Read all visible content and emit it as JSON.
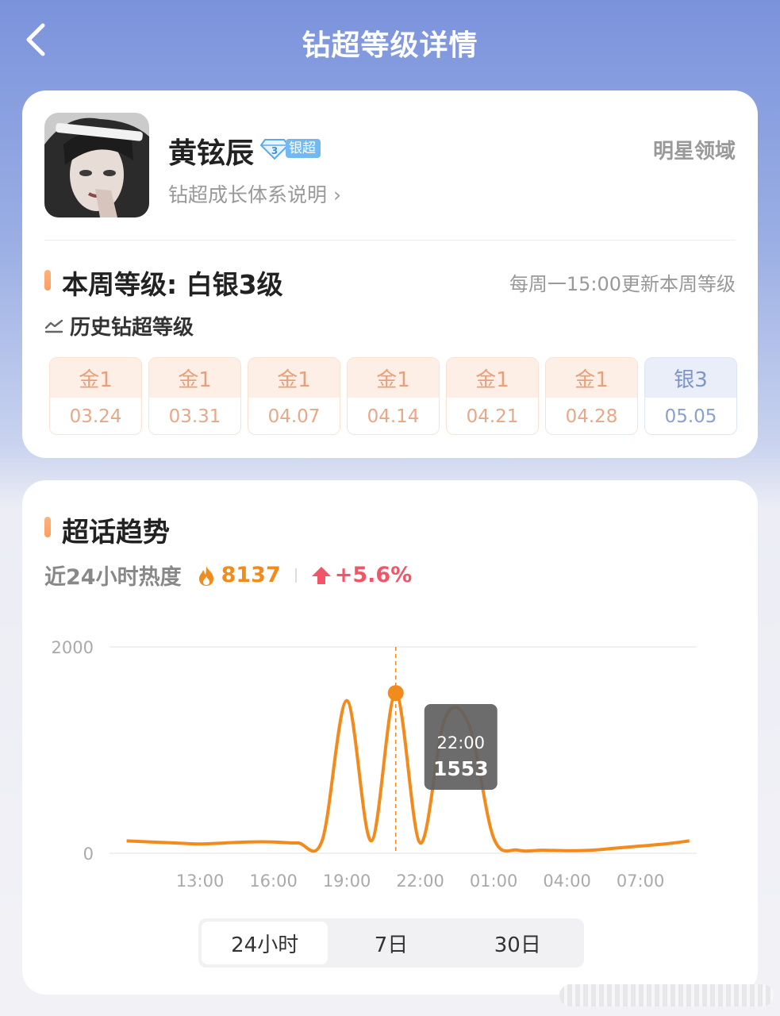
{
  "header": {
    "title": "钻超等级详情",
    "back_icon": "chevron-left-icon"
  },
  "profile": {
    "name": "黄铉辰",
    "badge_icon": "diamond-icon",
    "badge_level_digit": "3",
    "badge_label": "银超",
    "explain_link": "钻超成长体系说明 ›",
    "domain_label": "明星领域"
  },
  "level": {
    "current": "本周等级: 白银3级",
    "update_note": "每周一15:00更新本周等级",
    "history_title": "历史钻超等级",
    "history_icon": "trend-icon",
    "history": [
      {
        "level": "金1",
        "date": "03.24",
        "tier": "gold"
      },
      {
        "level": "金1",
        "date": "03.31",
        "tier": "gold"
      },
      {
        "level": "金1",
        "date": "04.07",
        "tier": "gold"
      },
      {
        "level": "金1",
        "date": "04.14",
        "tier": "gold"
      },
      {
        "level": "金1",
        "date": "04.21",
        "tier": "gold"
      },
      {
        "level": "金1",
        "date": "04.28",
        "tier": "gold"
      },
      {
        "level": "银3",
        "date": "05.05",
        "tier": "silver"
      }
    ]
  },
  "trend": {
    "title": "超话趋势",
    "heat_label": "近24小时热度",
    "heat_value": "8137",
    "heat_icon": "flame-icon",
    "change_icon": "arrow-up-icon",
    "change_value": "+5.6%",
    "tooltip": {
      "time": "22:00",
      "value": "1553"
    },
    "tabs": [
      "24小时",
      "7日",
      "30日"
    ],
    "active_tab": 0,
    "colors": {
      "line": "#f28a1c",
      "heat": "#f28a1c",
      "change": "#f25468"
    }
  },
  "chart_data": {
    "type": "line",
    "title": "",
    "xlabel": "",
    "ylabel": "",
    "ylim": [
      0,
      2000
    ],
    "yticks": [
      "2000",
      "0"
    ],
    "xtick_labels": [
      "13:00",
      "16:00",
      "19:00",
      "22:00",
      "01:00",
      "04:00",
      "07:00"
    ],
    "grid": true,
    "series": [
      {
        "x": [
          10,
          11,
          12,
          13,
          14,
          15,
          16,
          17,
          18,
          19,
          20,
          21,
          22,
          23,
          24,
          25,
          26,
          27,
          28,
          29,
          30,
          31,
          32,
          33
        ],
        "values": [
          120,
          110,
          100,
          90,
          100,
          110,
          110,
          100,
          130,
          1480,
          120,
          1553,
          100,
          1300,
          1240,
          150,
          30,
          30,
          25,
          30,
          50,
          70,
          90,
          120
        ]
      }
    ],
    "highlight": {
      "x_label": "22:00",
      "value": 1553
    }
  }
}
